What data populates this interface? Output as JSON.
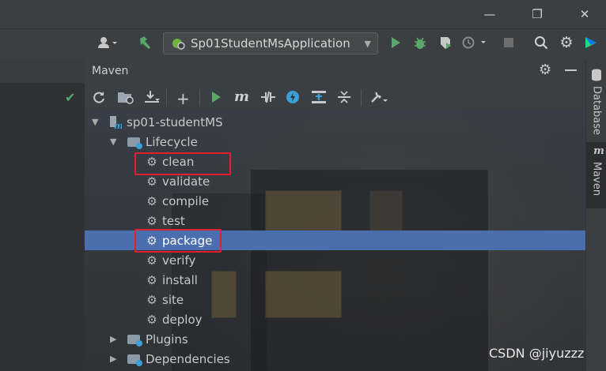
{
  "window": {
    "minimize": "—",
    "restore": "❐",
    "close": "✕"
  },
  "toolbar": {
    "run_config": "Sp01StudentMsApplication",
    "icons": [
      "user-icon",
      "build-hammer-icon",
      "run-icon",
      "debug-icon",
      "coverage-icon",
      "profile-icon",
      "stop-icon",
      "search-icon",
      "settings-icon",
      "toolbox-icon"
    ]
  },
  "maven": {
    "title": "Maven",
    "toolbar_icons": [
      "reload-icon",
      "generate-sources-icon",
      "download-icon",
      "add-icon",
      "run-maven-build-icon",
      "execute-maven-goal-icon",
      "toggle-offline-icon",
      "skip-tests-icon",
      "show-dependencies-icon",
      "collapse-all-icon",
      "maven-settings-icon"
    ],
    "project": "sp01-studentMS",
    "lifecycle": {
      "label": "Lifecycle",
      "goals": [
        "clean",
        "validate",
        "compile",
        "test",
        "package",
        "verify",
        "install",
        "site",
        "deploy"
      ],
      "selected": "package",
      "highlighted": [
        "clean",
        "package"
      ]
    },
    "plugins": "Plugins",
    "dependencies": "Dependencies"
  },
  "sidebar": {
    "database": "Database",
    "maven": "Maven"
  },
  "watermark": "CSDN @jiyuzzz",
  "colors": {
    "selection": "#4b6eaf",
    "highlight_box": "#e0202a",
    "run_green": "#59a869"
  }
}
